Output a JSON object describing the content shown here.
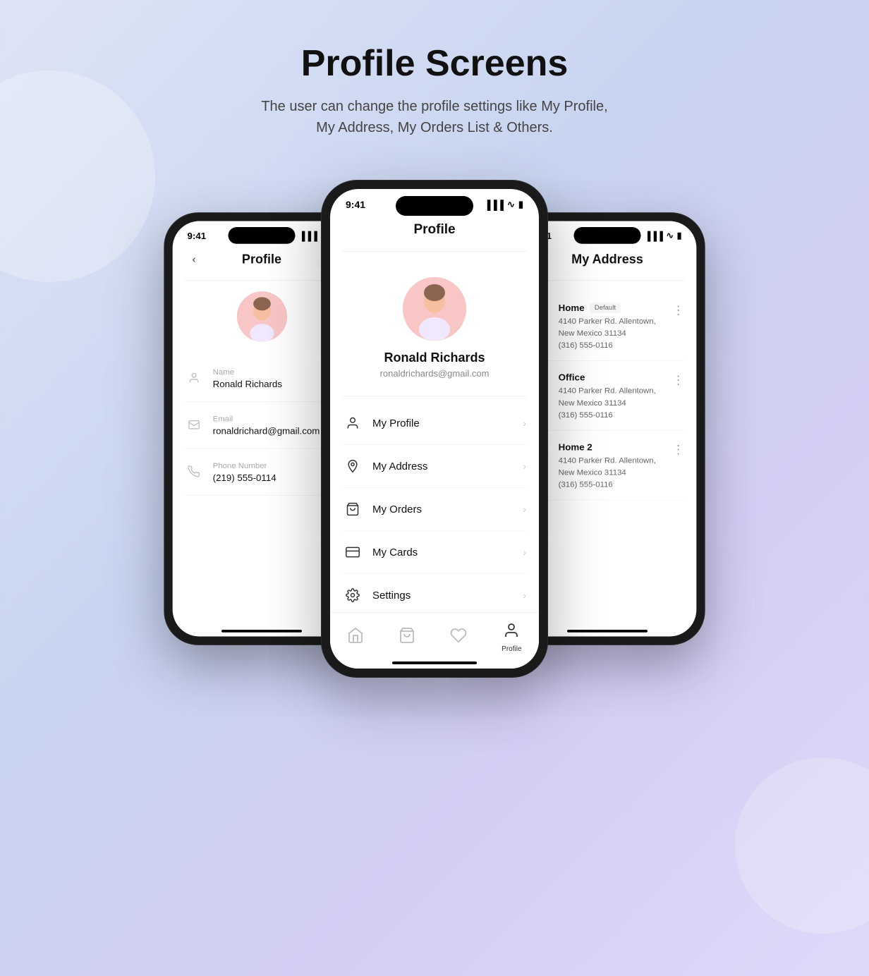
{
  "page": {
    "title": "Profile Screens",
    "subtitle": "The user can change the profile settings like My Profile, My Address, My Orders List & Others."
  },
  "phones": {
    "left": {
      "time": "9:41",
      "title": "Profile",
      "avatar_alt": "Ronald Richards avatar",
      "fields": [
        {
          "label": "Name",
          "value": "Ronald Richards",
          "icon": "person"
        },
        {
          "label": "Email",
          "value": "ronaldrichard@gmail.com",
          "icon": "email"
        },
        {
          "label": "Phone Number",
          "value": "(219) 555-0114",
          "icon": "phone"
        }
      ]
    },
    "center": {
      "time": "9:41",
      "title": "Profile",
      "user": {
        "name": "Ronald Richards",
        "email": "ronaldrichards@gmail.com"
      },
      "menu_items": [
        {
          "label": "My Profile",
          "icon": "person"
        },
        {
          "label": "My Address",
          "icon": "location"
        },
        {
          "label": "My Orders",
          "icon": "bag"
        },
        {
          "label": "My Cards",
          "icon": "card"
        },
        {
          "label": "Settings",
          "icon": "settings"
        }
      ],
      "bottom_nav": [
        {
          "label": "",
          "icon": "home",
          "active": false
        },
        {
          "label": "",
          "icon": "bag",
          "active": false
        },
        {
          "label": "",
          "icon": "heart",
          "active": false
        },
        {
          "label": "Profile",
          "icon": "person",
          "active": true
        }
      ]
    },
    "right": {
      "time": "9:41",
      "title": "My Address",
      "addresses": [
        {
          "name": "Home",
          "default": true,
          "street": "4140 Parker Rd. Allentown, New Mexico 31134",
          "phone": "(316) 555-0116"
        },
        {
          "name": "Office",
          "default": false,
          "street": "4140 Parker Rd. Allentown, New Mexico 31134",
          "phone": "(316) 555-0116"
        },
        {
          "name": "Home 2",
          "default": false,
          "street": "4140 Parker Rd. Allentown, New Mexico 31134",
          "phone": "(316) 555-0116"
        }
      ]
    }
  }
}
